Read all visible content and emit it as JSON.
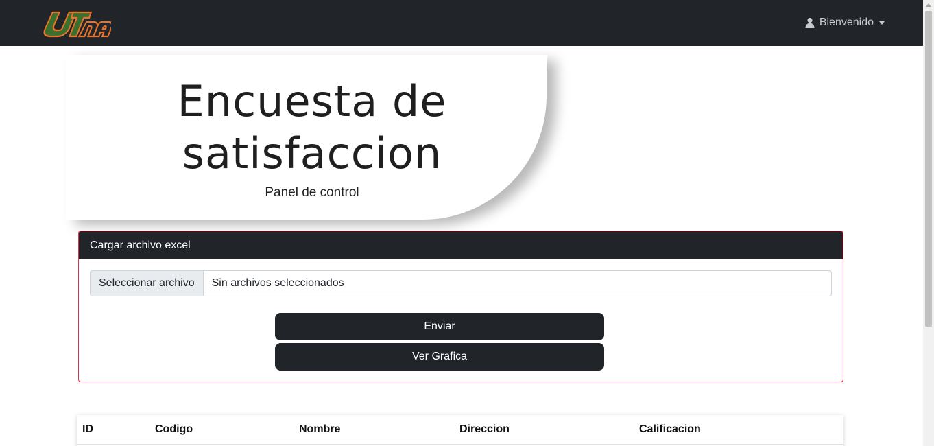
{
  "navbar": {
    "logo_text": "UTNA",
    "user_menu_label": "Bienvenido",
    "user_icon": "user-icon",
    "colors": {
      "background": "#212529",
      "logo_green": "#3a6f2e",
      "logo_orange": "#e8732a"
    }
  },
  "hero": {
    "title_line1": "Encuesta de",
    "title_line2": "satisfaccion",
    "subtitle": "Panel de control"
  },
  "upload_card": {
    "header": "Cargar archivo excel",
    "file_button_label": "Seleccionar archivo",
    "file_status": "Sin archivos seleccionados",
    "send_button_label": "Enviar",
    "chart_button_label": "Ver Grafica",
    "border_color": "#dc3545"
  },
  "table": {
    "columns": [
      "ID",
      "Codigo",
      "Nombre",
      "Direccion",
      "Calificacion"
    ]
  }
}
